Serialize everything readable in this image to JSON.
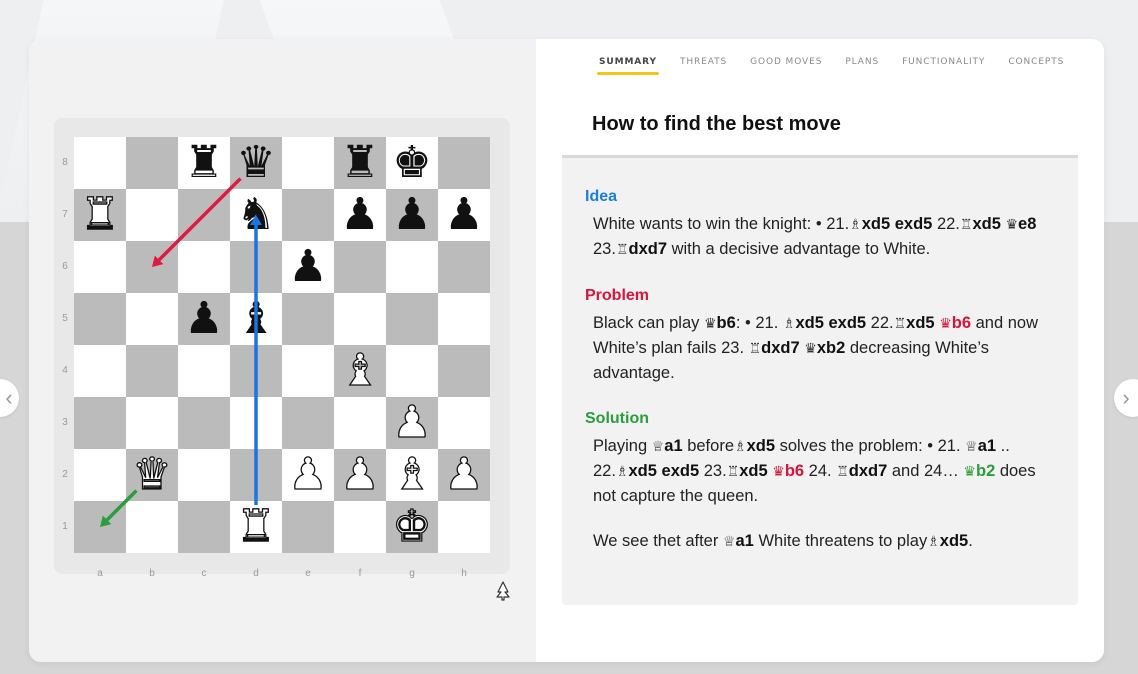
{
  "tabs": [
    {
      "label": "SUMMARY",
      "active": true
    },
    {
      "label": "THREATS",
      "active": false
    },
    {
      "label": "GOOD MOVES",
      "active": false
    },
    {
      "label": "PLANS",
      "active": false
    },
    {
      "label": "FUNCTIONALITY",
      "active": false
    },
    {
      "label": "CONCEPTS",
      "active": false
    }
  ],
  "heading": "How to find the best move",
  "colors": {
    "accent_tab": "#f5c518",
    "idea": "#1a7fe0",
    "problem": "#d9143a",
    "solution": "#2a9d3c",
    "arrow_red": "#e0193f",
    "arrow_blue": "#1a73e8",
    "arrow_green": "#2a9d3c"
  },
  "sections": {
    "idea": {
      "title": "Idea",
      "parts": [
        {
          "t": "White wants to win the knight: • 21."
        },
        {
          "g": "♗"
        },
        {
          "b": "xd5"
        },
        {
          "t": "  "
        },
        {
          "b": "exd5"
        },
        {
          "t": "  22."
        },
        {
          "g": "♖"
        },
        {
          "b": "xd5"
        },
        {
          "t": " "
        },
        {
          "g": "♛",
          "bold": true
        },
        {
          "b": "e8"
        },
        {
          "t": "  23."
        },
        {
          "g": "♖"
        },
        {
          "b": "dxd7"
        },
        {
          "t": " with a decisive advantage to White."
        }
      ]
    },
    "problem": {
      "title": "Problem",
      "parts": [
        {
          "t": "Black can play "
        },
        {
          "g": "♛",
          "bold": true
        },
        {
          "b": "b6"
        },
        {
          "t": ": • 21. "
        },
        {
          "g": "♗"
        },
        {
          "b": "xd5"
        },
        {
          "t": "  "
        },
        {
          "b": "exd5"
        },
        {
          "t": "  22."
        },
        {
          "g": "♖"
        },
        {
          "b": "xd5"
        },
        {
          "t": "  "
        },
        {
          "g": "♛",
          "bold": true,
          "color": "red"
        },
        {
          "b": "b6",
          "color": "red"
        },
        {
          "t": " and now White’s plan fails  23. "
        },
        {
          "g": "♖"
        },
        {
          "b": "dxd7"
        },
        {
          "t": " "
        },
        {
          "g": "♛",
          "bold": true
        },
        {
          "b": "xb2"
        },
        {
          "t": " decreasing White’s advantage."
        }
      ]
    },
    "solution": {
      "title": "Solution",
      "parts": [
        {
          "t": "Playing "
        },
        {
          "g": "♕"
        },
        {
          "b": "a1"
        },
        {
          "t": " before"
        },
        {
          "g": "♗"
        },
        {
          "b": "xd5"
        },
        {
          "t": " solves the problem: • 21. "
        },
        {
          "g": "♕"
        },
        {
          "b": "a1"
        },
        {
          "t": " .. 22."
        },
        {
          "g": "♗"
        },
        {
          "b": "xd5"
        },
        {
          "t": "  "
        },
        {
          "b": "exd5"
        },
        {
          "t": "  23."
        },
        {
          "g": "♖"
        },
        {
          "b": "xd5"
        },
        {
          "t": " "
        },
        {
          "g": "♛",
          "bold": true,
          "color": "red"
        },
        {
          "b": "b6",
          "color": "red"
        },
        {
          "t": "  24. "
        },
        {
          "g": "♖"
        },
        {
          "b": "dxd7"
        },
        {
          "t": " and  24… "
        },
        {
          "g": "♛",
          "bold": true,
          "color": "green"
        },
        {
          "b": "b2",
          "color": "green"
        },
        {
          "t": " does not capture the queen."
        }
      ],
      "extra_parts": [
        {
          "t": "We see thet after "
        },
        {
          "g": "♕"
        },
        {
          "b": "a1"
        },
        {
          "t": " White threatens to play"
        },
        {
          "g": "♗"
        },
        {
          "b": "xd5"
        },
        {
          "t": "."
        }
      ]
    }
  },
  "board": {
    "ranks": [
      "8",
      "7",
      "6",
      "5",
      "4",
      "3",
      "2",
      "1"
    ],
    "files": [
      "a",
      "b",
      "c",
      "d",
      "e",
      "f",
      "g",
      "h"
    ],
    "pieces": {
      "c8": "r",
      "d8": "q",
      "f8": "r",
      "g8": "k",
      "a7": "R",
      "d7": "n",
      "f7": "p",
      "g7": "p",
      "h7": "p",
      "e6": "p",
      "c5": "p",
      "d5": "b",
      "f4": "B",
      "g3": "P",
      "b2": "Q",
      "e2": "P",
      "f2": "P",
      "g2": "B",
      "h2": "P",
      "d1": "R",
      "g1": "K"
    },
    "arrows": [
      {
        "from": "d8",
        "to": "b6",
        "color": "red"
      },
      {
        "from": "d1",
        "to": "d7",
        "color": "blue"
      },
      {
        "from": "b2",
        "to": "a1",
        "color": "green"
      }
    ]
  },
  "icons": {
    "tree": "tree-icon",
    "prev": "‹",
    "next": "›"
  }
}
